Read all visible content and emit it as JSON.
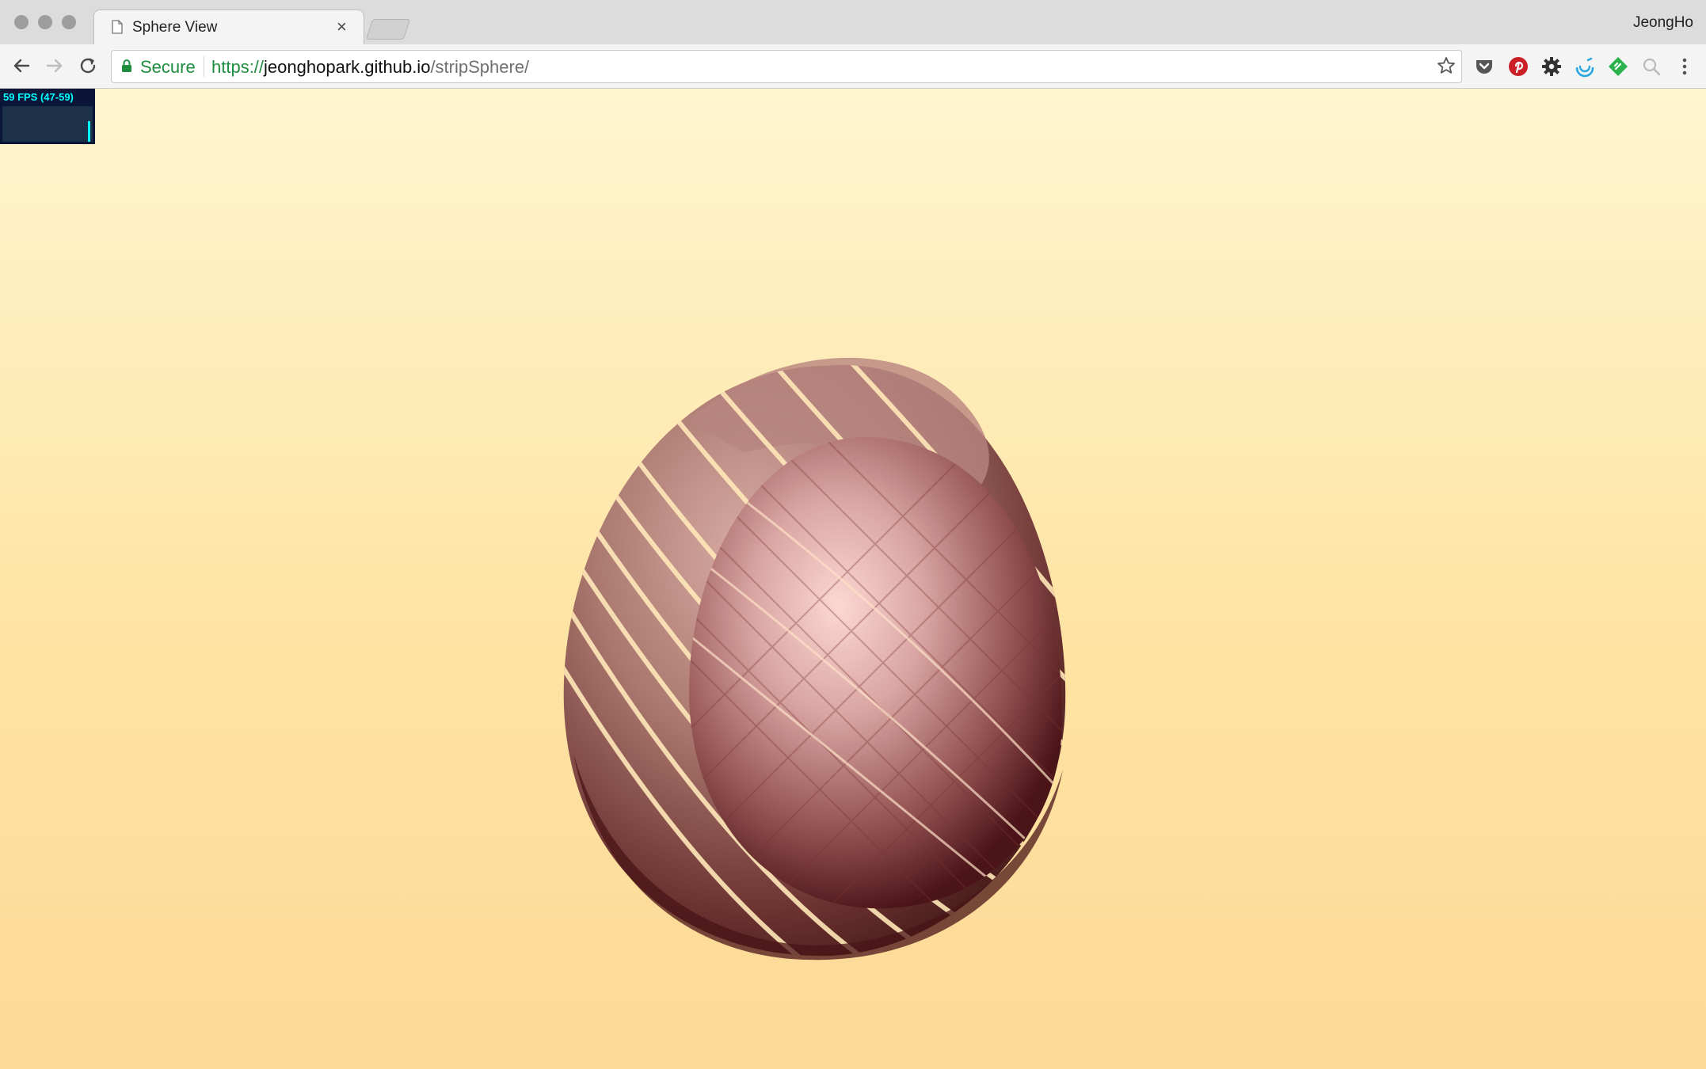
{
  "window": {
    "tab_title": "Sphere View",
    "tab_close": "×",
    "profile_name": "JeongHo"
  },
  "toolbar": {
    "secure_label": "Secure",
    "url_scheme": "https://",
    "url_host": "jeonghopark.github.io",
    "url_path": "/stripSphere/",
    "extensions": [
      "pocket-icon",
      "pinterest-icon",
      "gear-icon",
      "swirl-icon",
      "feedly-icon",
      "magnifier-icon",
      "menu-icon"
    ]
  },
  "stats": {
    "fps_label": "59 FPS (47-59)"
  },
  "colors": {
    "bg_top": "#fff5cf",
    "bg_bottom": "#fdd996",
    "sphere_base": "#c48e8e",
    "sphere_dark": "#5a1a1c",
    "stats_text": "#00ffff"
  }
}
